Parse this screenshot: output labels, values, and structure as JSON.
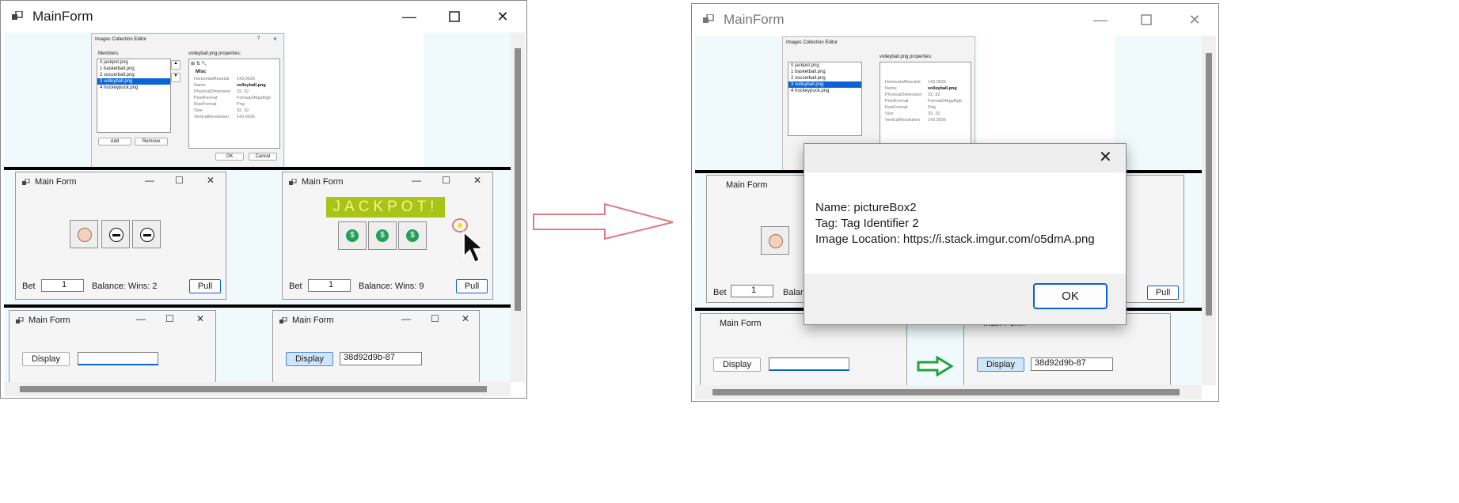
{
  "left_window": {
    "title": "MainForm",
    "editor": {
      "title": "Images Collection Editor",
      "members_label": "Members:",
      "members": [
        "0  jackpot.png",
        "1  basketball.png",
        "2  soccerball.png",
        "3  volleyball.png",
        "4  hockeypuck.png"
      ],
      "selected_index": 3,
      "properties_label": "volleyball.png properties:",
      "misc": "Misc",
      "props": [
        {
          "name": "HorizontalResoluti",
          "value": "143.9926"
        },
        {
          "name": "Name",
          "value": "volleyball.png"
        },
        {
          "name": "PhysicalDimension",
          "value": "32, 32"
        },
        {
          "name": "PixelFormat",
          "value": "Format24bppRgb"
        },
        {
          "name": "RawFormat",
          "value": "Png"
        },
        {
          "name": "Size",
          "value": "32, 32"
        },
        {
          "name": "VerticalResolution",
          "value": "143.9926"
        }
      ],
      "add": "Add",
      "remove": "Remove",
      "ok": "OK",
      "cancel": "Cancel",
      "help": "?",
      "close": "✕"
    },
    "slot_a": {
      "title": "Main Form",
      "bet_label": "Bet",
      "bet_value": "1",
      "balance": "Balance:  Wins: 2",
      "pull": "Pull"
    },
    "slot_b": {
      "title": "Main Form",
      "jackpot": "JACKPOT!",
      "bet_label": "Bet",
      "bet_value": "1",
      "balance": "Balance:  Wins: 9",
      "pull": "Pull"
    },
    "display_a": {
      "title": "Main Form",
      "display": "Display",
      "text_value": ""
    },
    "display_b": {
      "title": "Main Form",
      "display": "Display",
      "text_value": "38d92d9b-87"
    }
  },
  "right_window": {
    "title": "MainForm",
    "dialog": {
      "line1": "Name: pictureBox2",
      "line2": "Tag: Tag Identifier 2",
      "line3": "Image Location: https://i.stack.imgur.com/o5dmA.png",
      "ok": "OK"
    },
    "bet_value": "1",
    "bet_label": "Bet",
    "balance_fragment": "Balan",
    "pull": "Pull",
    "display": "Display",
    "text_value": "38d92d9b-87",
    "title_fragment": "Main Form"
  },
  "colors": {
    "arrow_outline": "#e07b84",
    "green_arrow": "#1fa33a",
    "jackpot_bg": "#a8c418",
    "jackpot_text": "#f3f58a",
    "selection": "#0a64d4"
  }
}
